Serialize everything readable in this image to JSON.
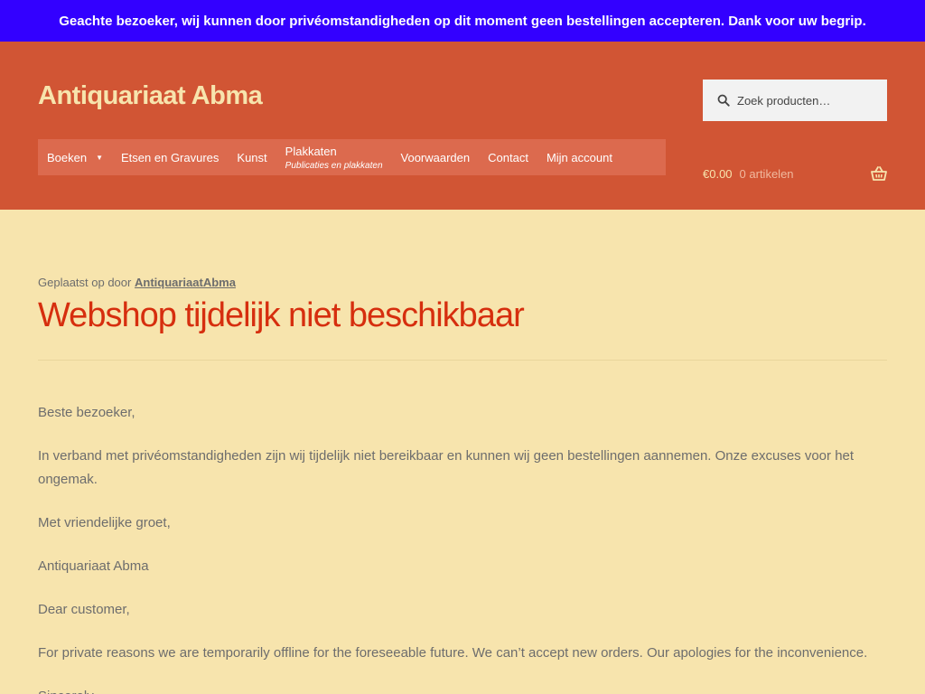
{
  "notice": "Geachte bezoeker, wij kunnen door privéomstandigheden op dit moment geen bestellingen accepteren. Dank voor uw begrip.",
  "site_title": "Antiquariaat Abma",
  "search": {
    "placeholder": "Zoek producten…",
    "icon": "search-icon"
  },
  "nav": {
    "items": [
      {
        "label": "Boeken",
        "has_dropdown": true
      },
      {
        "label": "Etsen en Gravures"
      },
      {
        "label": "Kunst"
      },
      {
        "label": "Plakkaten",
        "description": "Publicaties en plakkaten"
      },
      {
        "label": "Voorwaarden"
      },
      {
        "label": "Contact"
      },
      {
        "label": "Mijn account"
      }
    ]
  },
  "cart": {
    "amount": "€0.00",
    "count": "0 artikelen",
    "icon": "basket-icon"
  },
  "post": {
    "meta_prefix": "Geplaatst op door",
    "author": "AntiquariaatAbma",
    "title": "Webshop tijdelijk niet beschikbaar",
    "paragraphs": [
      "Beste bezoeker,",
      "In verband met privéomstandigheden zijn wij tijdelijk niet bereikbaar en kunnen wij geen bestellingen aannemen. Onze excuses voor het ongemak.",
      "Met vriendelijke groet,",
      "Antiquariaat Abma",
      "Dear customer,",
      "For private reasons we are temporarily offline for the foreseeable future. We can’t accept new orders. Our apologies for the inconvenience.",
      "Sincerely,"
    ]
  },
  "colors": {
    "notice_bg": "#3300ff",
    "header_bg": "#d15534",
    "nav_bg": "#dc6a4e",
    "page_bg": "#f7e4ad",
    "title_color": "#d62e0e"
  }
}
